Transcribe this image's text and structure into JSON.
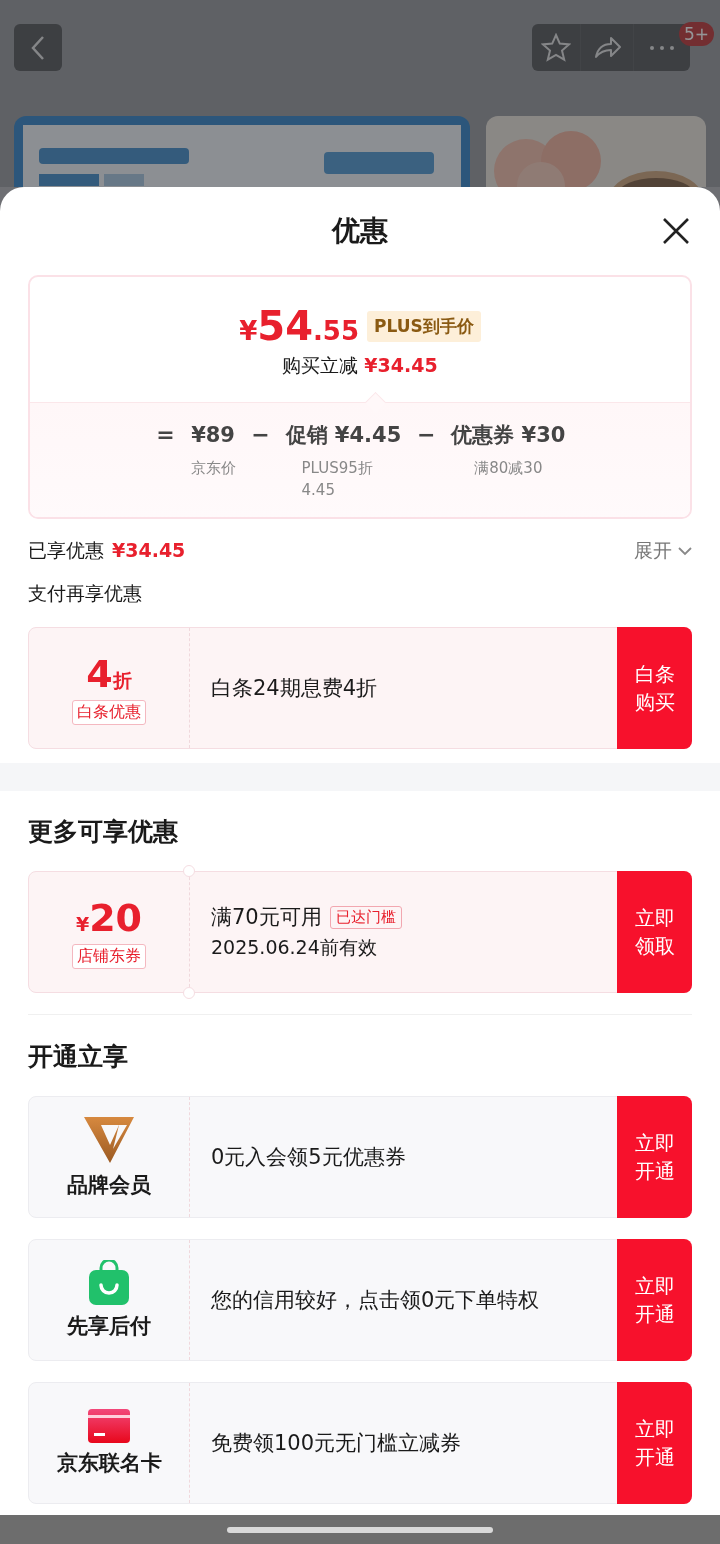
{
  "backdrop": {
    "badge": "5+"
  },
  "sheet": {
    "title": "优惠"
  },
  "price_card": {
    "currency": "¥",
    "price_int": "54",
    "price_dec": ".55",
    "price_tag": "PLUS到手价",
    "saving_label": "购买立减",
    "saving": "¥34.45",
    "breakdown": [
      {
        "operator": "=",
        "amount": "¥89",
        "note_lines": [
          "京东价"
        ]
      },
      {
        "operator": "−",
        "amount": "促销 ¥4.45",
        "note_lines": [
          "PLUS95折",
          "4.45"
        ]
      },
      {
        "operator": "−",
        "amount": "优惠券 ¥30",
        "note_lines": [
          "满80减30"
        ]
      }
    ]
  },
  "summary": {
    "label": "已享优惠",
    "amount": "¥34.45",
    "toggle": "展开",
    "expanded": false
  },
  "sections": [
    {
      "title": "支付再享优惠",
      "offers": [
        {
          "kind": "discount",
          "value": "4",
          "unit": "折",
          "tag": "白条优惠",
          "text": "白条24期息费4折",
          "action": "白条购买"
        }
      ]
    },
    {
      "title": "更多可享优惠",
      "offers": [
        {
          "kind": "coupon",
          "currency": "¥",
          "value": "20",
          "tag": "店铺东券",
          "text": "满70元可用",
          "badge": "已达门槛",
          "subtext": "2025.06.24前有效",
          "action": "立即领取"
        }
      ]
    },
    {
      "title": "开通立享",
      "offers": [
        {
          "kind": "member",
          "name": "品牌会员",
          "text": "0元入会领5元优惠券",
          "action": "立即开通"
        },
        {
          "kind": "paylater",
          "name": "先享后付",
          "text": "您的信用较好，点击领0元下单特权",
          "action": "立即开通"
        },
        {
          "kind": "cobrand",
          "name": "京东联名卡",
          "text": "免费领100元无门槛立减券",
          "action": "立即开通"
        }
      ]
    }
  ]
}
